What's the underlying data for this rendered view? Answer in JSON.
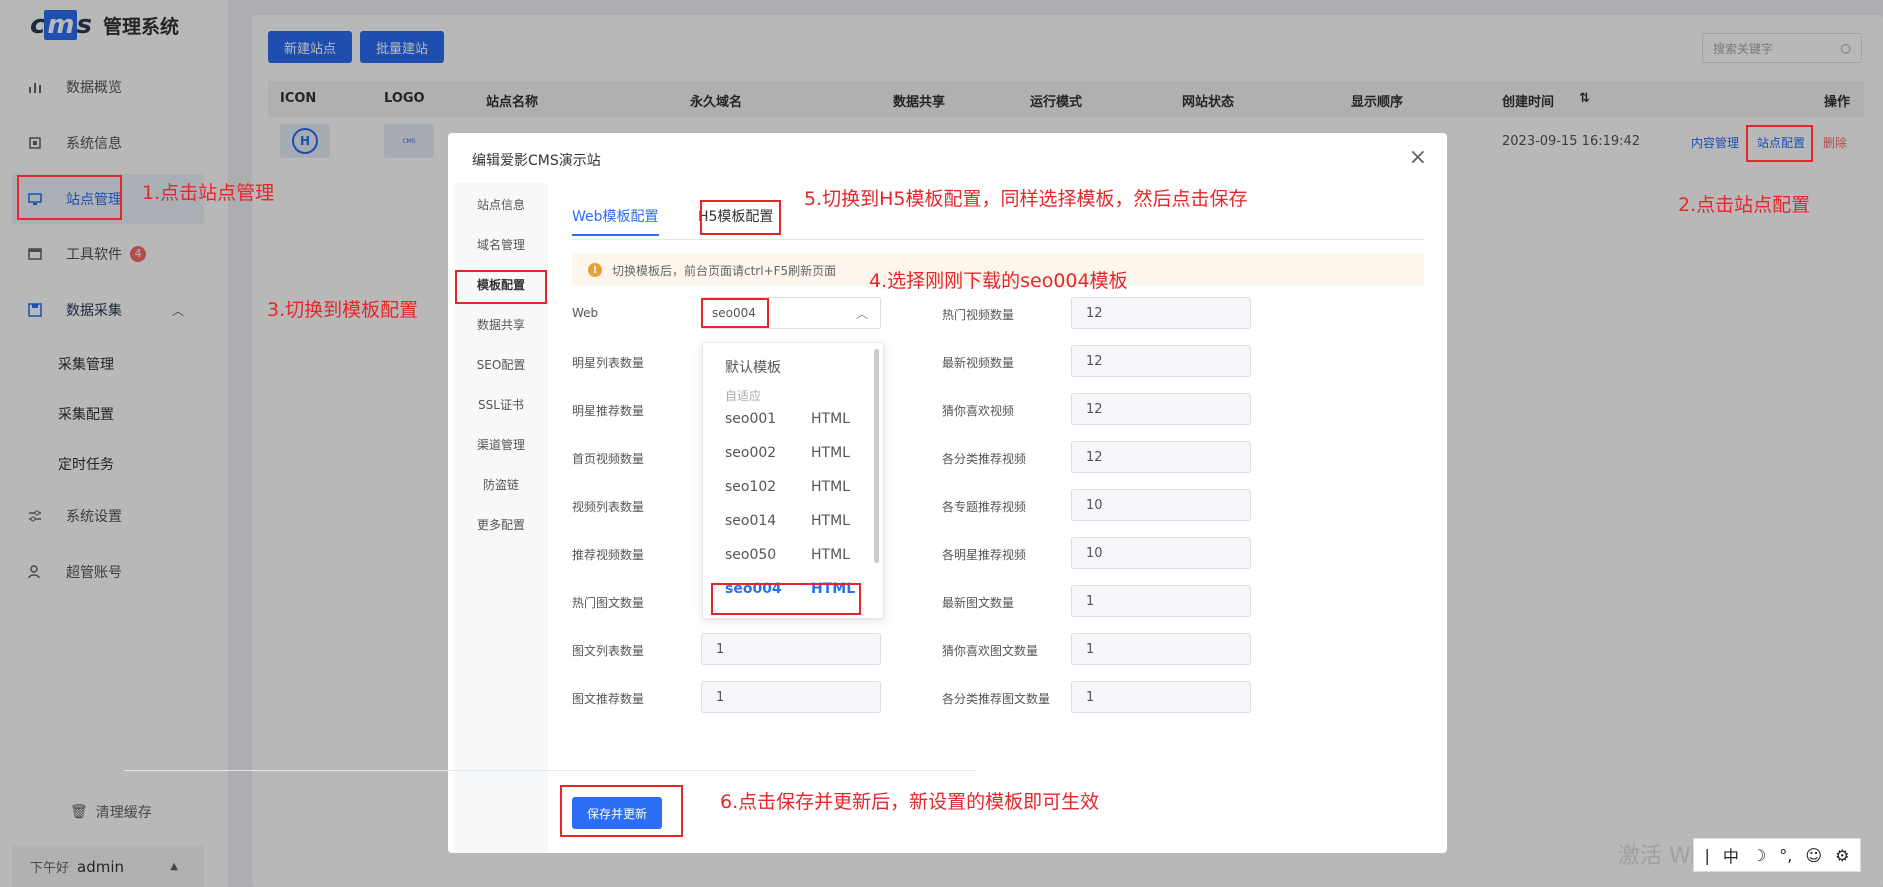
{
  "brand": {
    "logo": "cms",
    "title": "管理系统"
  },
  "sidebar": {
    "items": [
      {
        "label": "数据概览",
        "icon": "bar-chart-icon"
      },
      {
        "label": "系统信息",
        "icon": "chip-icon"
      },
      {
        "label": "站点管理",
        "icon": "monitor-icon"
      },
      {
        "label": "工具软件",
        "icon": "window-icon",
        "badge": "4"
      },
      {
        "label": "数据采集",
        "icon": "save-icon"
      },
      {
        "label": "系统设置",
        "icon": "sliders-icon"
      },
      {
        "label": "超管账号",
        "icon": "user-icon"
      }
    ],
    "sub_items": [
      "采集管理",
      "采集配置",
      "定时任务"
    ],
    "clear_cache": "清理缓存",
    "greeting": "下午好",
    "username": "admin"
  },
  "toolbar": {
    "new_site": "新建站点",
    "batch_new": "批量建站",
    "search_placeholder": "搜索关键字"
  },
  "table": {
    "headers": [
      "ICON",
      "LOGO",
      "站点名称",
      "永久域名",
      "数据共享",
      "运行模式",
      "网站状态",
      "显示顺序",
      "创建时间",
      "操作"
    ],
    "row": {
      "icon_text": "H",
      "logo_text": "CMS",
      "created": "2023-09-15 16:19:42",
      "ops": [
        "内容管理",
        "站点配置",
        "删除"
      ]
    }
  },
  "modal": {
    "title": "编辑爱影CMS演示站",
    "side_items": [
      "站点信息",
      "域名管理",
      "模板配置",
      "数据共享",
      "SEO配置",
      "SSL证书",
      "渠道管理",
      "防盗链",
      "更多配置"
    ],
    "tabs": [
      "Web模板配置",
      "H5模板配置"
    ],
    "notice": "切换模板后，前台页面请ctrl+F5刷新页面",
    "web_label": "Web",
    "web_value": "seo004",
    "left_fields": [
      {
        "label": "明星列表数量"
      },
      {
        "label": "明星推荐数量"
      },
      {
        "label": "首页视频数量"
      },
      {
        "label": "视频列表数量"
      },
      {
        "label": "推荐视频数量"
      },
      {
        "label": "热门图文数量"
      },
      {
        "label": "图文列表数量",
        "value": "1"
      },
      {
        "label": "图文推荐数量",
        "value": "1"
      }
    ],
    "right_fields": [
      {
        "label": "热门视频数量",
        "value": "12"
      },
      {
        "label": "最新视频数量",
        "value": "12"
      },
      {
        "label": "猜你喜欢视频",
        "value": "12"
      },
      {
        "label": "各分类推荐视频",
        "value": "12"
      },
      {
        "label": "各专题推荐视频",
        "value": "10"
      },
      {
        "label": "各明星推荐视频",
        "value": "10"
      },
      {
        "label": "最新图文数量",
        "value": "1"
      },
      {
        "label": "猜你喜欢图文数量",
        "value": "1"
      },
      {
        "label": "各分类推荐图文数量",
        "value": "1"
      }
    ],
    "dropdown": {
      "default": "默认模板",
      "group": "自适应",
      "options": [
        {
          "name": "seo001",
          "tag": "HTML"
        },
        {
          "name": "seo002",
          "tag": "HTML"
        },
        {
          "name": "seo102",
          "tag": "HTML"
        },
        {
          "name": "seo014",
          "tag": "HTML"
        },
        {
          "name": "seo050",
          "tag": "HTML"
        },
        {
          "name": "seo004",
          "tag": "HTML"
        }
      ]
    },
    "save_label": "保存并更新"
  },
  "annotations": {
    "a1": "1.点击站点管理",
    "a2": "2.点击站点配置",
    "a3": "3.切换到模板配置",
    "a4": "4.选择刚刚下载的seo004模板",
    "a5": "5.切换到H5模板配置，同样选择模板，然后点击保存",
    "a6": "6.点击保存并更新后，新设置的模板即可生效"
  },
  "watermark": "激活 Windows",
  "ime": {
    "mode": "中"
  },
  "colors": {
    "accent": "#2b6df5",
    "annotation": "#e8262a",
    "danger": "#f56c6c"
  }
}
